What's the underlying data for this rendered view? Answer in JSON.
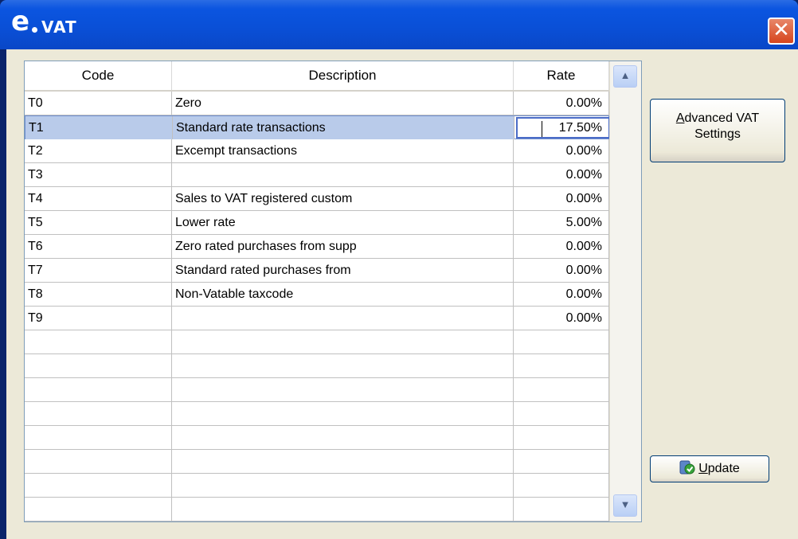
{
  "window": {
    "title": "VAT",
    "logo": "e"
  },
  "grid": {
    "columns": [
      "Code",
      "Description",
      "Rate"
    ],
    "rows": [
      {
        "code": "T0",
        "description": "Zero",
        "rate": "0.00%"
      },
      {
        "code": "T1",
        "description": "Standard rate transactions",
        "rate": "17.50%"
      },
      {
        "code": "T2",
        "description": "Excempt transactions",
        "rate": "0.00%"
      },
      {
        "code": "T3",
        "description": "",
        "rate": "0.00%"
      },
      {
        "code": "T4",
        "description": "Sales to VAT registered custom",
        "rate": "0.00%"
      },
      {
        "code": "T5",
        "description": "Lower rate",
        "rate": "5.00%"
      },
      {
        "code": "T6",
        "description": "Zero rated purchases from supp",
        "rate": "0.00%"
      },
      {
        "code": "T7",
        "description": "Standard rated purchases from",
        "rate": "0.00%"
      },
      {
        "code": "T8",
        "description": "Non-Vatable taxcode",
        "rate": "0.00%"
      },
      {
        "code": "T9",
        "description": "",
        "rate": "0.00%"
      }
    ],
    "selected_index": 1
  },
  "buttons": {
    "advanced_line1_prefix": "A",
    "advanced_line1_rest": "dvanced VAT",
    "advanced_line2": "Settings",
    "update_prefix": "U",
    "update_rest": "pdate"
  }
}
